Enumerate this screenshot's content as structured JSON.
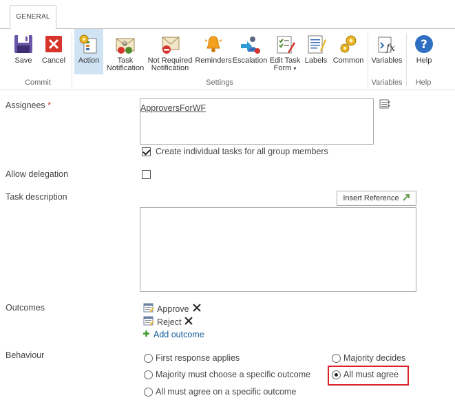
{
  "ribbon": {
    "tab": "GENERAL",
    "groups": {
      "commit": "Commit",
      "settings": "Settings",
      "variables": "Variables",
      "help": "Help"
    },
    "buttons": {
      "save": "Save",
      "cancel": "Cancel",
      "action": "Action",
      "task_notification_1": "Task",
      "task_notification_2": "Notification",
      "not_required_1": "Not Required",
      "not_required_2": "Notification",
      "reminders": "Reminders",
      "escalation": "Escalation",
      "edit_task_form_1": "Edit Task",
      "edit_task_form_2": "Form",
      "labels": "Labels",
      "common": "Common",
      "variables": "Variables",
      "help": "Help"
    }
  },
  "form": {
    "assignees": {
      "label": "Assignees",
      "required_mark": "*",
      "value": "ApproversForWF",
      "create_individual_label": "Create individual tasks for all group members",
      "create_individual_checked": true
    },
    "allow_delegation": {
      "label": "Allow delegation",
      "checked": false
    },
    "task_description": {
      "label": "Task description",
      "insert_reference": "Insert Reference",
      "value": ""
    },
    "outcomes": {
      "label": "Outcomes",
      "items": [
        "Approve",
        "Reject"
      ],
      "add_label": "Add outcome"
    },
    "behaviour": {
      "label": "Behaviour",
      "options": {
        "first_response": "First response applies",
        "majority_specific": "Majority must choose a specific outcome",
        "all_specific": "All must agree on a specific outcome",
        "majority_decides": "Majority decides",
        "all_agree": "All must agree"
      },
      "selected": "all_agree"
    }
  },
  "colors": {
    "accent_link": "#0f5a98",
    "selected_button_bg": "#cfe3f5",
    "required": "#c0392b",
    "highlight": "#d9222a"
  }
}
